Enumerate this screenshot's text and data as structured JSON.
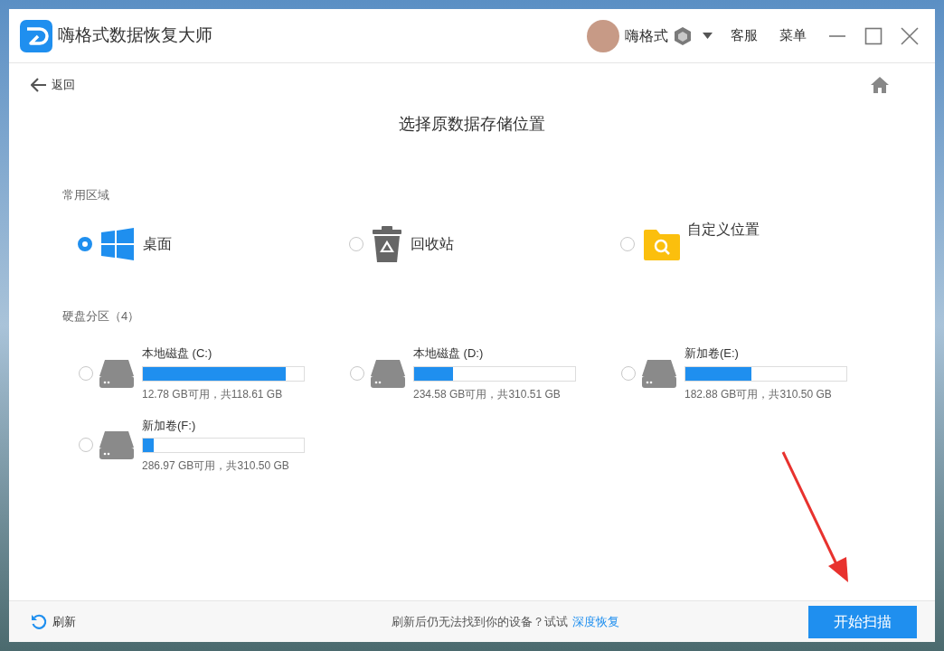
{
  "window": {
    "title": "嗨格式数据恢复大师"
  },
  "account": {
    "username": "嗨格式"
  },
  "header_links": [
    "客服",
    "菜单"
  ],
  "back": {
    "label": "返回"
  },
  "heading": "选择原数据存储位置",
  "common_section": {
    "title": "常用区域",
    "items": [
      {
        "kind": "desktop",
        "label": "桌面",
        "selected": true
      },
      {
        "kind": "recycle",
        "label": "回收站",
        "selected": false
      },
      {
        "kind": "custom",
        "label": "自定义位置",
        "selected": false
      }
    ]
  },
  "disk_section": {
    "title": "硬盘分区（4）",
    "drives": [
      {
        "name": "本地磁盘 (C:)",
        "level": 0.89,
        "capacity": "12.78 GB可用，共118.61 GB",
        "selected": false
      },
      {
        "name": "本地磁盘 (D:)",
        "level": 0.24,
        "capacity": "234.58 GB可用，共310.51 GB",
        "selected": false
      },
      {
        "name": "新加卷(E:)",
        "level": 0.41,
        "capacity": "182.88 GB可用，共310.50 GB",
        "selected": false
      },
      {
        "name": "新加卷(F:)",
        "level": 0.07,
        "capacity": "286.97 GB可用，共310.50 GB",
        "selected": false
      }
    ]
  },
  "footer": {
    "refresh": "刷新",
    "hint": "刷新后仍无法找到你的设备？试试",
    "link": "深度恢复",
    "scan_button": "开始扫描"
  }
}
